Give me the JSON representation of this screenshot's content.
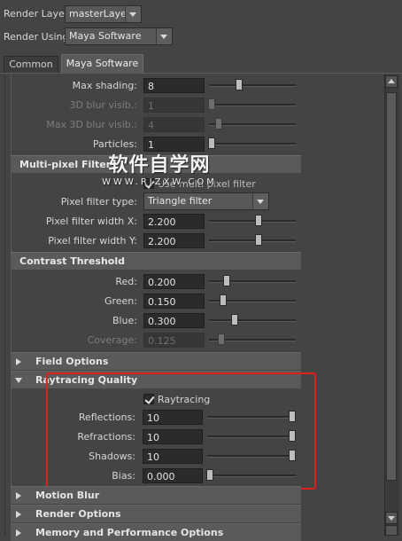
{
  "header": {
    "render_layer_label": "Render Layer",
    "render_layer_value": "masterLayer",
    "render_using_label": "Render Using",
    "render_using_value": "Maya Software"
  },
  "tabs": [
    {
      "label": "Common",
      "active": false
    },
    {
      "label": "Maya Software",
      "active": true
    }
  ],
  "top_rows": [
    {
      "label": "Max shading:",
      "value": "8",
      "enabled": true,
      "slider": 0.45
    },
    {
      "label": "3D blur visib.:",
      "value": "1",
      "enabled": false,
      "slider": 0.0
    },
    {
      "label": "Max 3D blur visib.:",
      "value": "4",
      "enabled": false,
      "slider": 0.05
    },
    {
      "label": "Particles:",
      "value": "1",
      "enabled": true,
      "slider": 0.0
    }
  ],
  "multipixel": {
    "title": "Multi-pixel Filter",
    "checkbox_label": "Use multi pixel filter",
    "pixel_filter_type_label": "Pixel filter type:",
    "pixel_filter_type_value": "Triangle filter",
    "width_x_label": "Pixel filter width X:",
    "width_x_value": "2.200",
    "width_x_slider": 0.6,
    "width_y_label": "Pixel filter width Y:",
    "width_y_value": "2.200",
    "width_y_slider": 0.6
  },
  "contrast": {
    "title": "Contrast Threshold",
    "rows": [
      {
        "label": "Red:",
        "value": "0.200",
        "enabled": true,
        "slider": 0.2
      },
      {
        "label": "Green:",
        "value": "0.150",
        "enabled": true,
        "slider": 0.15
      },
      {
        "label": "Blue:",
        "value": "0.300",
        "enabled": true,
        "slider": 0.3
      },
      {
        "label": "Coverage:",
        "value": "0.125",
        "enabled": false,
        "slider": 0.125
      }
    ]
  },
  "field_options": {
    "title": "Field Options"
  },
  "raytracing": {
    "title": "Raytracing Quality",
    "checkbox_label": "Raytracing",
    "rows": [
      {
        "label": "Reflections:",
        "value": "10",
        "slider": 1.0
      },
      {
        "label": "Refractions:",
        "value": "10",
        "slider": 1.0
      },
      {
        "label": "Shadows:",
        "value": "10",
        "slider": 1.0
      },
      {
        "label": "Bias:",
        "value": "0.000",
        "slider": 0.0
      }
    ]
  },
  "collapsed_sections": [
    {
      "title": "Motion Blur"
    },
    {
      "title": "Render Options"
    },
    {
      "title": "Memory and Performance Options"
    }
  ],
  "watermark": {
    "line1": "软件自学网",
    "line2": "WWW.RJZXW.COM"
  },
  "colors": {
    "highlight": "#e0201c",
    "panel": "#444444"
  }
}
